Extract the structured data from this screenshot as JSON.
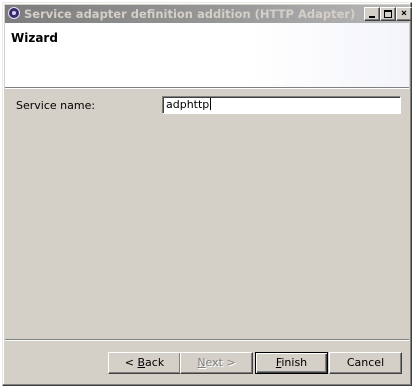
{
  "window": {
    "title": "Service adapter definition addition (HTTP Adapter)"
  },
  "header": {
    "title": "Wizard"
  },
  "form": {
    "service_name": {
      "label": "Service name:",
      "value": "adphttp"
    }
  },
  "buttons": {
    "back": {
      "arrow": "<",
      "mnemonic": "B",
      "rest": "ack"
    },
    "next": {
      "mnemonic": "N",
      "rest": "ext",
      "arrow": ">"
    },
    "finish": {
      "mnemonic": "F",
      "rest": "inish"
    },
    "cancel": {
      "label": "Cancel"
    }
  },
  "icons": {
    "app": "eclipse-icon",
    "minimize": "minimize-icon",
    "maximize": "maximize-icon",
    "close": "close-icon"
  },
  "colors": {
    "titlebar_start": "#7d7d7d",
    "titlebar_end": "#b9b9b9",
    "face": "#d4d0c8"
  }
}
